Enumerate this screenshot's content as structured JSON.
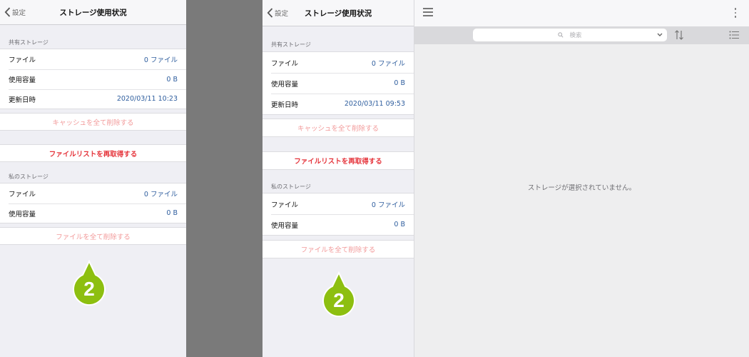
{
  "colors": {
    "accent_blue": "#2f5e9e",
    "danger_red": "#e5343b",
    "light_red": "#f29a9a",
    "badge_green": "#8dbf10"
  },
  "left": {
    "back_label": "設定",
    "title": "ストレージ使用状況",
    "shared_header": "共有ストレージ",
    "shared_rows": [
      {
        "label": "ファイル",
        "value": "0 ファイル"
      },
      {
        "label": "使用容量",
        "value": "0 B"
      },
      {
        "label": "更新日時",
        "value": "2020/03/11 10:23"
      }
    ],
    "clear_cache": "キャッシュを全て削除する",
    "refetch": "ファイルリストを再取得する",
    "private_header": "私のストレージ",
    "private_rows": [
      {
        "label": "ファイル",
        "value": "0 ファイル"
      },
      {
        "label": "使用容量",
        "value": "0 B"
      }
    ],
    "delete_files": "ファイルを全て削除する",
    "badge_number": "2"
  },
  "middle": {
    "back_label": "設定",
    "title": "ストレージ使用状況",
    "shared_header": "共有ストレージ",
    "shared_rows": [
      {
        "label": "ファイル",
        "value": "0 ファイル"
      },
      {
        "label": "使用容量",
        "value": "0 B"
      },
      {
        "label": "更新日時",
        "value": "2020/03/11 09:53"
      }
    ],
    "clear_cache": "キャッシュを全て削除する",
    "refetch": "ファイルリストを再取得する",
    "private_header": "私のストレージ",
    "private_rows": [
      {
        "label": "ファイル",
        "value": "0 ファイル"
      },
      {
        "label": "使用容量",
        "value": "0 B"
      }
    ],
    "delete_files": "ファイルを全て削除する",
    "badge_number": "2"
  },
  "right": {
    "search_placeholder": "検索",
    "empty_message": "ストレージが選択されていません。",
    "icons": [
      "hamburger-menu-icon",
      "more-vertical-icon",
      "search-icon",
      "chevron-down-icon",
      "sort-icon",
      "list-view-icon"
    ]
  }
}
